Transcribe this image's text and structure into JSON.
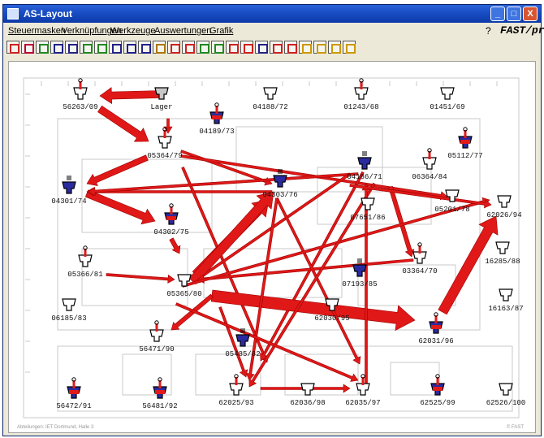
{
  "window": {
    "title": "AS-Layout"
  },
  "title_buttons": {
    "minimize": "_",
    "maximize": "□",
    "close": "X"
  },
  "menu": [
    "Steuermasken",
    "Verknüpfungen",
    "Werkzeuge",
    "Auswertungen",
    "Grafik"
  ],
  "help_mark": "?",
  "brand": "FAST/pro",
  "toolbar_colors": [
    "#c22",
    "#b03",
    "#282",
    "#228",
    "#228",
    "#282",
    "#282",
    "#228",
    "#228",
    "#228",
    "#aa7700",
    "#c22",
    "#c22",
    "#282",
    "#282",
    "#c22",
    "#c22",
    "#228",
    "#c22",
    "#c22",
    "#cc9900",
    "#cc9900",
    "#cc9900",
    "#cc9900"
  ],
  "footer": {
    "left": "Abteilungen: IET Dortmund, Halle 3",
    "right": "© FAST"
  },
  "stations": [
    {
      "id": "56263/09",
      "kind": "red"
    },
    {
      "id": "Lager",
      "kind": "gray"
    },
    {
      "id": "04188/72",
      "kind": "white"
    },
    {
      "id": "01243/68",
      "kind": "red"
    },
    {
      "id": "01451/69",
      "kind": "white"
    },
    {
      "id": "04189/73",
      "kind": "mixed"
    },
    {
      "id": "05364/79",
      "kind": "red"
    },
    {
      "id": "05112/77",
      "kind": "mixed"
    },
    {
      "id": "04186/71",
      "kind": "blue"
    },
    {
      "id": "06364/84",
      "kind": "red"
    },
    {
      "id": "04301/74",
      "kind": "blue"
    },
    {
      "id": "04303/76",
      "kind": "blue"
    },
    {
      "id": "07651/86",
      "kind": "white"
    },
    {
      "id": "05201/78",
      "kind": "white"
    },
    {
      "id": "62026/94",
      "kind": "white"
    },
    {
      "id": "04302/75",
      "kind": "mixed"
    },
    {
      "id": "05366/81",
      "kind": "red"
    },
    {
      "id": "03364/70",
      "kind": "red"
    },
    {
      "id": "16285/88",
      "kind": "white"
    },
    {
      "id": "07193/85",
      "kind": "blue"
    },
    {
      "id": "05365/80",
      "kind": "white"
    },
    {
      "id": "16163/87",
      "kind": "white"
    },
    {
      "id": "06185/83",
      "kind": "white"
    },
    {
      "id": "62030/95",
      "kind": "white"
    },
    {
      "id": "62031/96",
      "kind": "mixed"
    },
    {
      "id": "56471/90",
      "kind": "red"
    },
    {
      "id": "05485/82",
      "kind": "blue"
    },
    {
      "id": "56472/91",
      "kind": "mixed"
    },
    {
      "id": "56481/92",
      "kind": "mixed"
    },
    {
      "id": "62025/93",
      "kind": "red"
    },
    {
      "id": "62036/98",
      "kind": "white"
    },
    {
      "id": "62035/97",
      "kind": "red"
    },
    {
      "id": "62525/99",
      "kind": "mixed"
    },
    {
      "id": "62526/100",
      "kind": "white"
    }
  ]
}
